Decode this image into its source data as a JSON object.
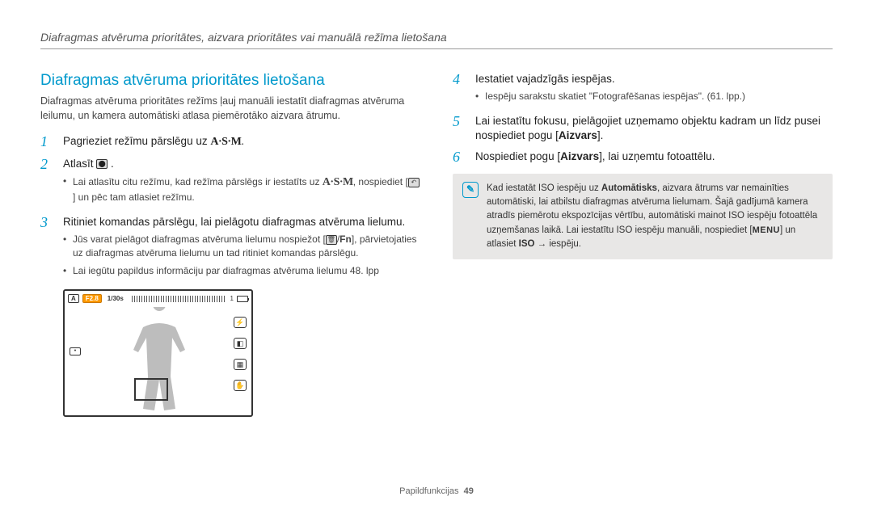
{
  "header": "Diafragmas atvēruma prioritātes, aizvara prioritātes vai manuālā režīma lietošana",
  "title": "Diafragmas atvēruma prioritātes lietošana",
  "intro": "Diafragmas atvēruma prioritātes režīms ļauj manuāli iestatīt diafragmas atvēruma leilumu, un kamera automātiski atlasa piemērotāko aizvara ātrumu.",
  "steps_left": {
    "1": {
      "text_a": "Pagrieziet režīmu pārslēgu uz ",
      "mode": "A·S·M",
      "text_b": "."
    },
    "2": {
      "text": "Atlasīt ",
      "sub_a": "Lai atlasītu citu režīmu, kad režīma pārslēgs ir iestatīts uz ",
      "sub_mode": "A·S·M",
      "sub_b": ", nospiediet [",
      "sub_c": "] un pēc tam atlasiet režīmu."
    },
    "3": {
      "text": "Ritiniet komandas pārslēgu, lai pielāgotu diafragmas atvēruma lielumu.",
      "sub_a_1": "Jūs varat pielāgot diafragmas atvēruma lielumu nospiežot [",
      "sub_a_fn": "Fn",
      "sub_a_2": "], pārvietojaties uz diafragmas atvēruma lielumu un tad ritiniet komandas pārslēgu.",
      "sub_b": "Lai iegūtu papildus informāciju par diafragmas atvēruma lielumu 48. lpp"
    }
  },
  "steps_right": {
    "4": {
      "text": "Iestatiet vajadzīgās iespējas.",
      "sub": "Iespēju sarakstu skatiet \"Fotografēšanas iespējas\". (61. lpp.)"
    },
    "5": {
      "text_a": "Lai iestatītu fokusu, pielāgojiet uzņemamo objektu kadram un līdz pusei nospiediet pogu [",
      "bold": "Aizvars",
      "text_b": "]."
    },
    "6": {
      "text_a": "Nospiediet pogu [",
      "bold": "Aizvars",
      "text_b": "], lai uzņemtu fotoattēlu."
    }
  },
  "note": {
    "a": "Kad iestatāt ISO iespēju uz ",
    "bold1": "Automātisks",
    "b": ", aizvara ātrums var nemainīties automātiski, lai atbilstu diafragmas atvēruma lielumam. Šajā gadījumā kamera atradīs piemērotu ekspozīcijas vērtību, automātiski mainot ISO iespēju fotoattēla uzņemšanas laikā. Lai iestatītu ISO iespēju manuāli, nospiediet [",
    "menu": "MENU",
    "c": "] un atlasiet ",
    "bold2": "ISO",
    "d": " → iespēju."
  },
  "camera": {
    "f": "F2.8",
    "shutter": "1/30s",
    "count": "1"
  },
  "footer": {
    "section": "Papildfunkcijas",
    "page": "49"
  }
}
